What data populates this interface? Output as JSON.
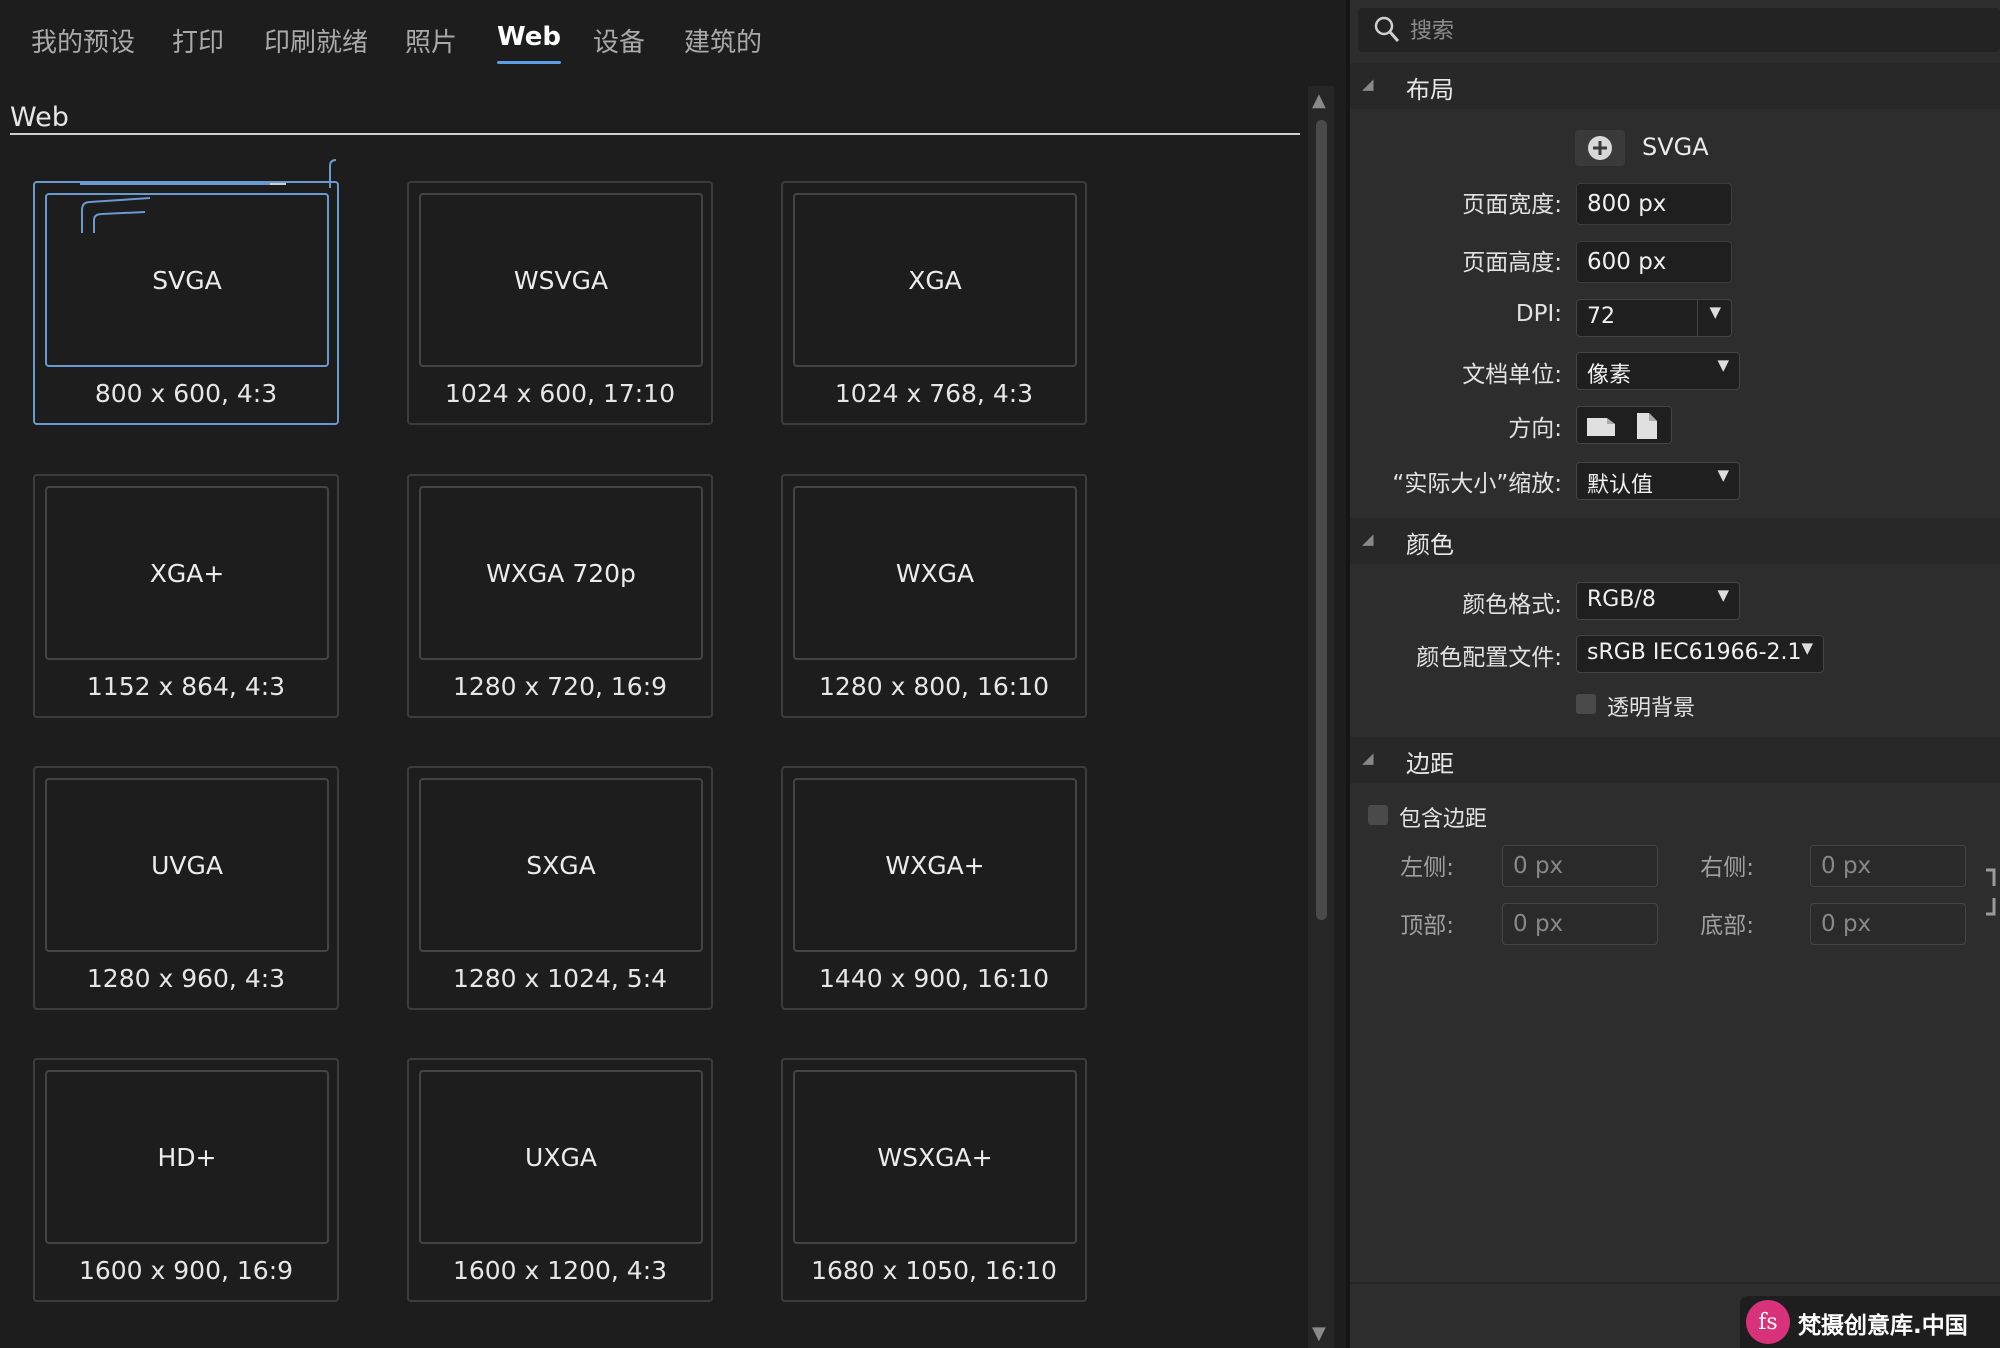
{
  "tabs": [
    {
      "label": "我的预设"
    },
    {
      "label": "打印"
    },
    {
      "label": "印刷就绪"
    },
    {
      "label": "照片"
    },
    {
      "label": "Web",
      "active": true
    },
    {
      "label": "设备"
    },
    {
      "label": "建筑的"
    }
  ],
  "section_title": "Web",
  "presets": [
    {
      "name": "SVGA",
      "size": "800 x 600, 4:3",
      "selected": true
    },
    {
      "name": "WSVGA",
      "size": "1024 x 600, 17:10"
    },
    {
      "name": "XGA",
      "size": "1024 x 768, 4:3"
    },
    {
      "name": "XGA+",
      "size": "1152 x 864, 4:3"
    },
    {
      "name": "WXGA 720p",
      "size": "1280 x 720, 16:9"
    },
    {
      "name": "WXGA",
      "size": "1280 x 800, 16:10"
    },
    {
      "name": "UVGA",
      "size": "1280 x 960, 4:3"
    },
    {
      "name": "SXGA",
      "size": "1280 x 1024, 5:4"
    },
    {
      "name": "WXGA+",
      "size": "1440 x 900, 16:10"
    },
    {
      "name": "HD+",
      "size": "1600 x 900, 16:9"
    },
    {
      "name": "UXGA",
      "size": "1600 x 1200, 4:3"
    },
    {
      "name": "WSXGA+",
      "size": "1680 x 1050, 16:10"
    }
  ],
  "search": {
    "placeholder": "搜索"
  },
  "layout": {
    "header": "布局",
    "preset_name": "SVGA",
    "page_width_label": "页面宽度:",
    "page_width_value": "800 px",
    "page_height_label": "页面高度:",
    "page_height_value": "600 px",
    "dpi_label": "DPI:",
    "dpi_value": "72",
    "unit_label": "文档单位:",
    "unit_value": "像素",
    "orientation_label": "方向:",
    "scale_label": "“实际大小”缩放:",
    "scale_value": "默认值"
  },
  "color": {
    "header": "颜色",
    "format_label": "颜色格式:",
    "format_value": "RGB/8",
    "profile_label": "颜色配置文件:",
    "profile_value": "sRGB IEC61966-2.1",
    "transparent_label": "透明背景"
  },
  "margins": {
    "header": "边距",
    "include_label": "包含边距",
    "left_label": "左侧:",
    "left_value": "0 px",
    "right_label": "右侧:",
    "right_value": "0 px",
    "top_label": "顶部:",
    "top_value": "0 px",
    "bottom_label": "底部:",
    "bottom_value": "0 px"
  },
  "watermark": {
    "logo": "fs",
    "text": "梵摄创意库.中国"
  },
  "colors": {
    "accent": "#5b9ee8",
    "selected_border": "#6b98cf",
    "bg_left": "#1d1d1d",
    "bg_right": "#2d2d2d"
  },
  "icons": {
    "search": "search-icon",
    "add": "plus-circle-icon",
    "landscape": "landscape-page-icon",
    "portrait": "portrait-page-icon"
  }
}
